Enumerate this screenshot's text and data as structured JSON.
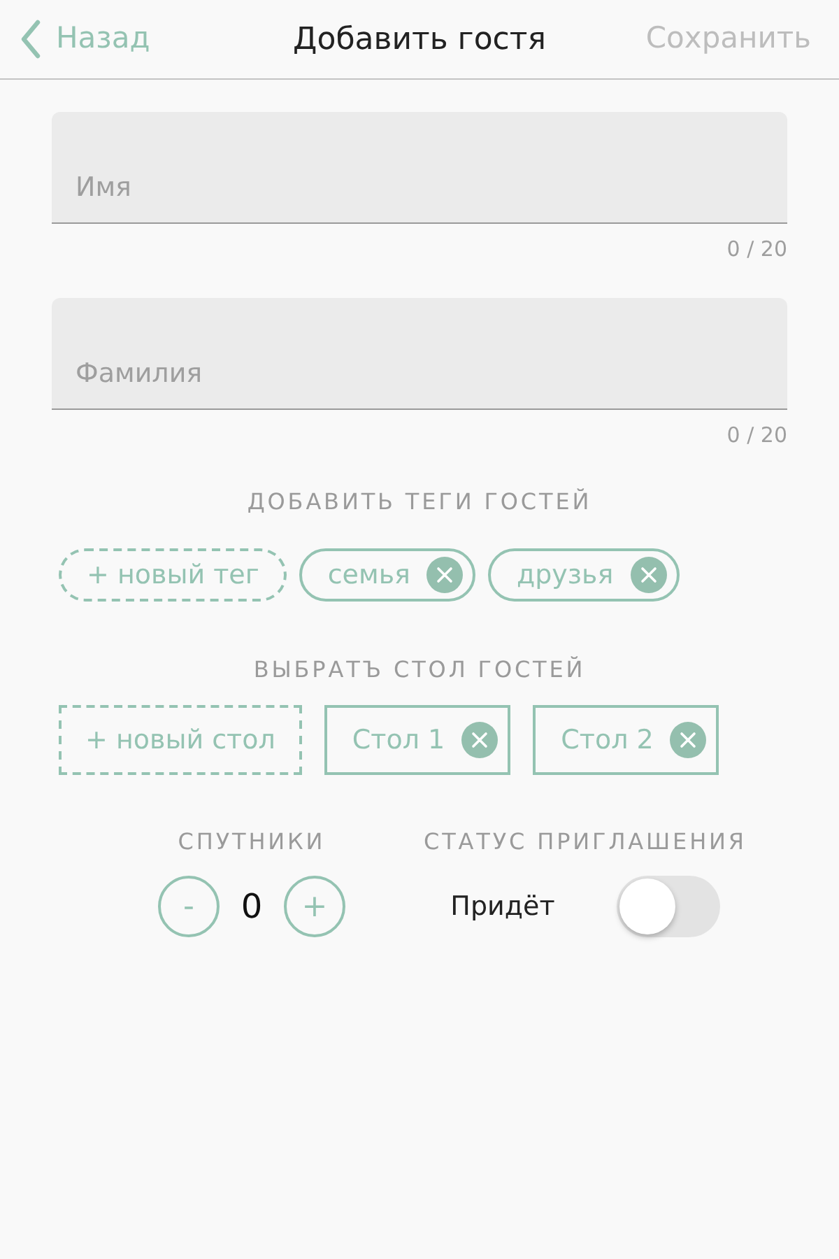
{
  "header": {
    "back_label": "Назад",
    "title": "Добавить гостя",
    "save_label": "Сохранить",
    "save_disabled": true
  },
  "fields": [
    {
      "placeholder": "Имя",
      "counter": "0 / 20"
    },
    {
      "placeholder": "Фамилия",
      "counter": "0 / 20"
    }
  ],
  "tags": {
    "heading": "ДОБАВИТЬ ТЕГИ ГОСТЕЙ",
    "add_label": "+ новый тег",
    "items": [
      {
        "label": "семья"
      },
      {
        "label": "друзья"
      }
    ]
  },
  "tables": {
    "heading": "ВЫБРАТЪ СТОЛ ГОСТЕЙ",
    "add_label": "+ новый стол",
    "items": [
      {
        "label": "Стол 1"
      },
      {
        "label": "Стол 2"
      }
    ]
  },
  "companions": {
    "heading": "СПУТНИКИ",
    "minus": "-",
    "value": "0",
    "plus": "+"
  },
  "invitation": {
    "heading": "СТАТУС ПРИГЛАШЕНИЯ",
    "label": "Придёт",
    "on": false
  }
}
